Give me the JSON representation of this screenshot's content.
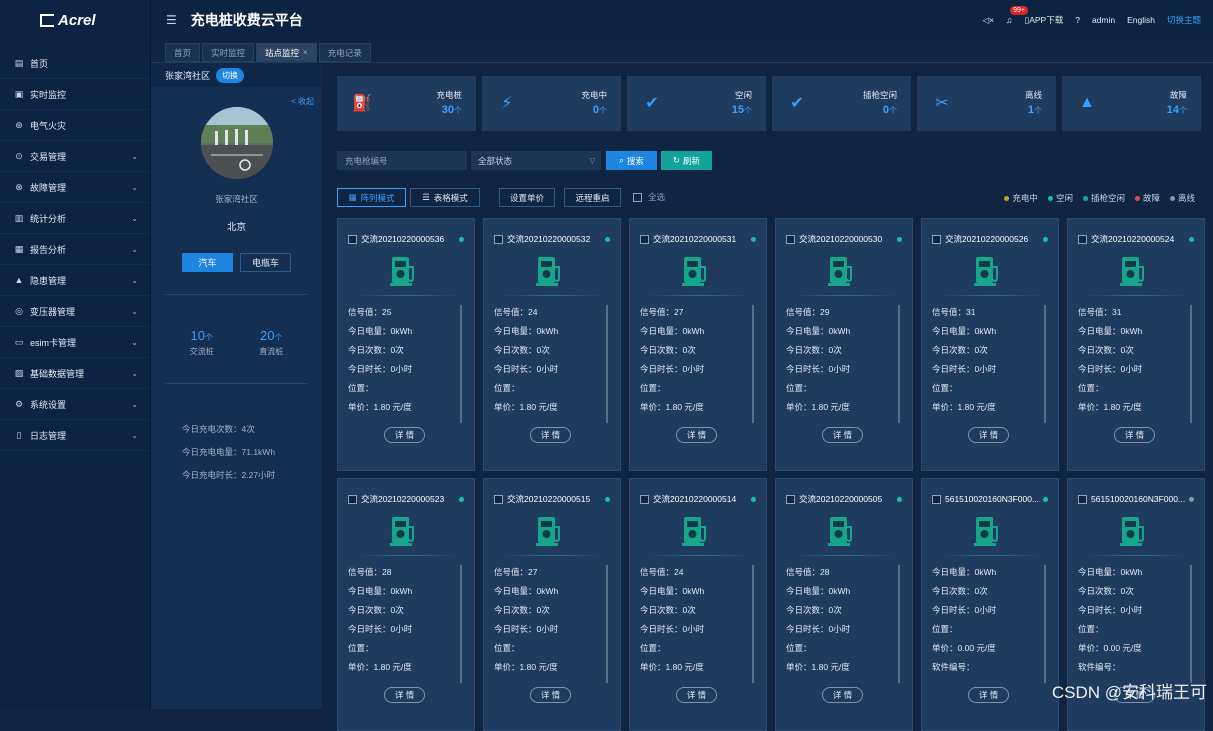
{
  "brand": {
    "logo_text": "Acrel",
    "app_title": "充电桩收费云平台"
  },
  "header": {
    "notification_count": "99+",
    "app_download": "APP下载",
    "user": "admin",
    "language": "English",
    "switch_theme": "切换主题"
  },
  "sidebar": {
    "items": [
      {
        "label": "首页",
        "icon": "home-icon",
        "expand": false
      },
      {
        "label": "实时监控",
        "icon": "monitor-icon",
        "expand": false
      },
      {
        "label": "电气火灾",
        "icon": "fire-icon",
        "expand": false
      },
      {
        "label": "交易管理",
        "icon": "transaction-icon",
        "expand": true
      },
      {
        "label": "故障管理",
        "icon": "fault-icon",
        "expand": true
      },
      {
        "label": "统计分析",
        "icon": "chart-icon",
        "expand": true
      },
      {
        "label": "报告分析",
        "icon": "report-icon",
        "expand": true
      },
      {
        "label": "隐患管理",
        "icon": "warning-icon",
        "expand": true
      },
      {
        "label": "变压器管理",
        "icon": "transformer-icon",
        "expand": true
      },
      {
        "label": "esim卡管理",
        "icon": "sim-card-icon",
        "expand": true
      },
      {
        "label": "基础数据管理",
        "icon": "database-icon",
        "expand": true
      },
      {
        "label": "系统设置",
        "icon": "settings-icon",
        "expand": true
      },
      {
        "label": "日志管理",
        "icon": "log-icon",
        "expand": true
      }
    ]
  },
  "tabs": [
    {
      "label": "首页",
      "active": false,
      "closable": false
    },
    {
      "label": "实时监控",
      "active": false,
      "closable": false
    },
    {
      "label": "站点监控",
      "active": true,
      "closable": true
    },
    {
      "label": "充电记录",
      "active": false,
      "closable": false
    }
  ],
  "station": {
    "name_header": "张家湾社区",
    "switch_label": "切换",
    "collapse_label": "< 收起",
    "name": "张家湾社区",
    "city": "北京",
    "type_buttons": [
      "汽车",
      "电瓶车"
    ],
    "ac_count": "10",
    "ac_unit": "个",
    "ac_label": "交流桩",
    "dc_count": "20",
    "dc_unit": "个",
    "dc_label": "直流桩",
    "today_lines": [
      "今日充电次数：4次",
      "今日充电电量：71.1kWh",
      "今日充电时长：2.27小时"
    ]
  },
  "stats": [
    {
      "label": "充电桩",
      "value": "30",
      "unit": "个",
      "icon": "charger-icon",
      "glyph": "⛽"
    },
    {
      "label": "充电中",
      "value": "0",
      "unit": "个",
      "icon": "lightning-icon",
      "glyph": "⚡"
    },
    {
      "label": "空闲",
      "value": "15",
      "unit": "个",
      "icon": "check-circle-icon",
      "glyph": "✔"
    },
    {
      "label": "插枪空闲",
      "value": "0",
      "unit": "个",
      "icon": "check-circle-icon",
      "glyph": "✔"
    },
    {
      "label": "离线",
      "value": "1",
      "unit": "个",
      "icon": "plug-icon",
      "glyph": "✂"
    },
    {
      "label": "故障",
      "value": "14",
      "unit": "个",
      "icon": "alert-triangle-icon",
      "glyph": "▲"
    }
  ],
  "filters": {
    "pile_placeholder": "充电枪编号",
    "status_value": "全部状态",
    "search_label": "搜索",
    "refresh_label": "刷新"
  },
  "mode_bar": {
    "array_mode": "阵列模式",
    "table_mode": "表格模式",
    "set_price": "设置单价",
    "remote_restart": "远程重启",
    "select_all": "全选"
  },
  "legend": [
    {
      "label": "充电中",
      "color": "#c9a21b"
    },
    {
      "label": "空闲",
      "color": "#12c3a6"
    },
    {
      "label": "插枪空闲",
      "color": "#1aa3a8"
    },
    {
      "label": "故障",
      "color": "#e04848"
    },
    {
      "label": "离线",
      "color": "#8a96a6"
    }
  ],
  "colors": {
    "accent": "#1e86e0",
    "teal": "#12a39a",
    "pile_icon": "#17a58c"
  },
  "cards": [
    {
      "name": "交流20210220000536",
      "status": "空闲",
      "info": [
        "信号值：25",
        "今日电量：0kWh",
        "今日次数：0次",
        "今日时长：0小时",
        "位置：",
        "单价：1.80 元/度"
      ],
      "detail": "详 情"
    },
    {
      "name": "交流20210220000532",
      "status": "空闲",
      "info": [
        "信号值：24",
        "今日电量：0kWh",
        "今日次数：0次",
        "今日时长：0小时",
        "位置：",
        "单价：1.80 元/度"
      ],
      "detail": "详 情"
    },
    {
      "name": "交流20210220000531",
      "status": "空闲",
      "info": [
        "信号值：27",
        "今日电量：0kWh",
        "今日次数：0次",
        "今日时长：0小时",
        "位置：",
        "单价：1.80 元/度"
      ],
      "detail": "详 情"
    },
    {
      "name": "交流20210220000530",
      "status": "空闲",
      "info": [
        "信号值：29",
        "今日电量：0kWh",
        "今日次数：0次",
        "今日时长：0小时",
        "位置：",
        "单价：1.80 元/度"
      ],
      "detail": "详 情"
    },
    {
      "name": "交流20210220000526",
      "status": "空闲",
      "info": [
        "信号值：31",
        "今日电量：0kWh",
        "今日次数：0次",
        "今日时长：0小时",
        "位置：",
        "单价：1.80 元/度"
      ],
      "detail": "详 情"
    },
    {
      "name": "交流20210220000524",
      "status": "空闲",
      "info": [
        "信号值：31",
        "今日电量：0kWh",
        "今日次数：0次",
        "今日时长：0小时",
        "位置：",
        "单价：1.80 元/度"
      ],
      "detail": "详 情"
    },
    {
      "name": "交流20210220000523",
      "status": "空闲",
      "info": [
        "信号值：28",
        "今日电量：0kWh",
        "今日次数：0次",
        "今日时长：0小时",
        "位置：",
        "单价：1.80 元/度"
      ],
      "detail": "详 情"
    },
    {
      "name": "交流20210220000515",
      "status": "空闲",
      "info": [
        "信号值：27",
        "今日电量：0kWh",
        "今日次数：0次",
        "今日时长：0小时",
        "位置：",
        "单价：1.80 元/度"
      ],
      "detail": "详 情"
    },
    {
      "name": "交流20210220000514",
      "status": "空闲",
      "info": [
        "信号值：24",
        "今日电量：0kWh",
        "今日次数：0次",
        "今日时长：0小时",
        "位置：",
        "单价：1.80 元/度"
      ],
      "detail": "详 情"
    },
    {
      "name": "交流20210220000505",
      "status": "空闲",
      "info": [
        "信号值：28",
        "今日电量：0kWh",
        "今日次数：0次",
        "今日时长：0小时",
        "位置：",
        "单价：1.80 元/度"
      ],
      "detail": "详 情"
    },
    {
      "name": "561510020160N3F000...",
      "status": "空闲",
      "info": [
        "今日电量：0kWh",
        "今日次数：0次",
        "今日时长：0小时",
        "位置：",
        "单价：0.00 元/度",
        "软件编号："
      ],
      "detail": "详 情"
    },
    {
      "name": "561510020160N3F000...",
      "status": "离线",
      "info": [
        "今日电量：0kWh",
        "今日次数：0次",
        "今日时长：0小时",
        "位置：",
        "单价：0.00 元/度",
        "软件编号："
      ],
      "detail": "详 情"
    }
  ],
  "watermark": "CSDN @安科瑞王可"
}
